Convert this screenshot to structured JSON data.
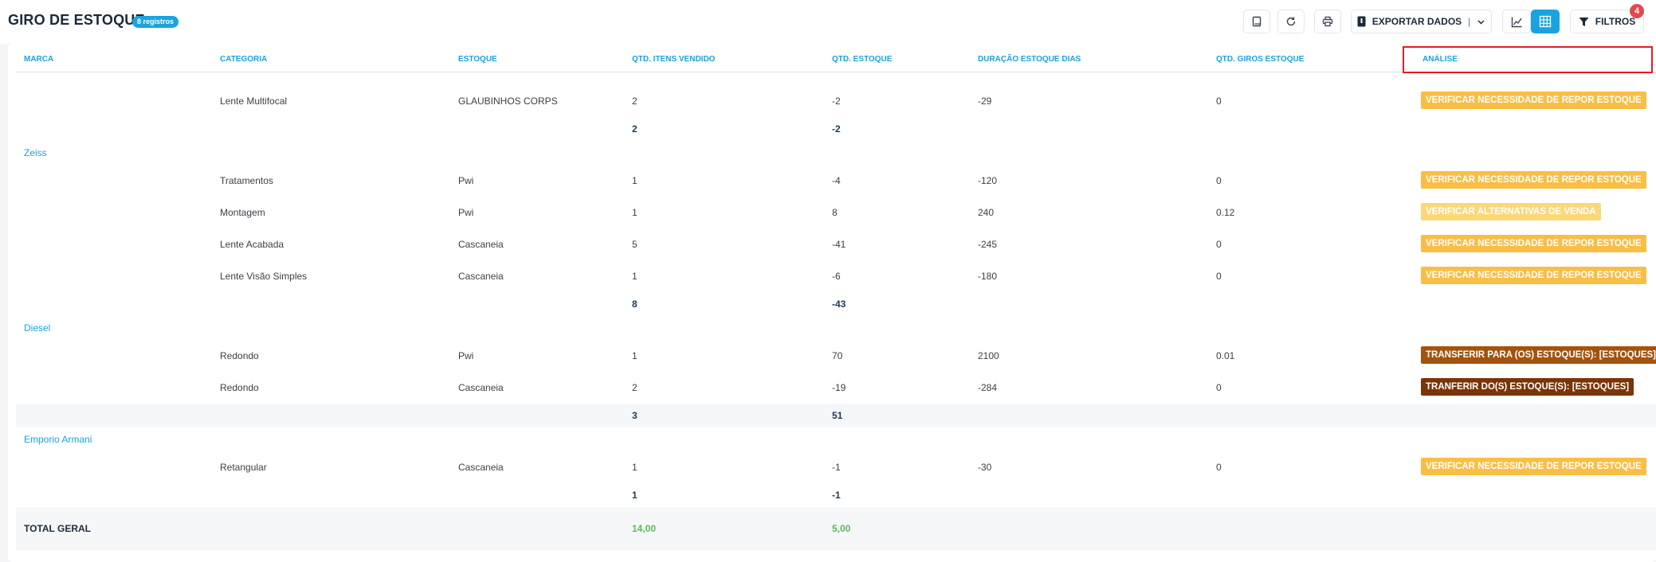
{
  "header": {
    "title": "GIRO DE ESTOQUE",
    "records_badge": "8 registros",
    "export_label": "EXPORTAR DADOS",
    "export_separator": "|",
    "filters_label": "FILTROS",
    "filters_count": "4"
  },
  "icons": {
    "book": "book-icon",
    "refresh": "refresh-icon",
    "print": "print-icon",
    "export": "export-file-icon",
    "chevron": "chevron-down-icon",
    "chart": "chart-icon",
    "grid": "grid-icon",
    "filter": "filter-icon"
  },
  "colors": {
    "accent": "#1aa3e0",
    "orange": "#f9be45",
    "yellow": "#fbd877",
    "brown": "#a3530e",
    "dark_brown": "#7b3407",
    "total_green": "#5cb85c",
    "highlight_red": "#e11d2a"
  },
  "table": {
    "columns": {
      "marca": "MARCA",
      "categoria": "CATEGORIA",
      "estoque": "ESTOQUE",
      "qtd_vendido": "QTD. ITENS VENDIDO",
      "qtd_estoque": "QTD. ESTOQUE",
      "duracao": "DURAÇÃO ESTOQUE DIAS",
      "giros": "QTD. GIROS ESTOQUE",
      "analise": "ANÁLISE"
    },
    "groups": [
      {
        "brand": "",
        "rows": [
          {
            "categoria": "Lente Multifocal",
            "estoque": "GLAUBINHOS CORPS",
            "vendido": "2",
            "estoque_qtd": "-2",
            "duracao": "-29",
            "giros": "0",
            "analise": "VERIFICAR NECESSIDADE DE REPOR ESTOQUE"
          }
        ],
        "subtotal": {
          "vendido": "2",
          "estoque_qtd": "-2"
        }
      },
      {
        "brand": "Zeiss",
        "rows": [
          {
            "categoria": "Tratamentos",
            "estoque": "Pwi",
            "vendido": "1",
            "estoque_qtd": "-4",
            "duracao": "-120",
            "giros": "0",
            "analise": "VERIFICAR NECESSIDADE DE REPOR ESTOQUE"
          },
          {
            "categoria": "Montagem",
            "estoque": "Pwi",
            "vendido": "1",
            "estoque_qtd": "8",
            "duracao": "240",
            "giros": "0.12",
            "analise": "VERIFICAR ALTERNATIVAS DE VENDA"
          },
          {
            "categoria": "Lente Acabada",
            "estoque": "Cascaneia",
            "vendido": "5",
            "estoque_qtd": "-41",
            "duracao": "-245",
            "giros": "0",
            "analise": "VERIFICAR NECESSIDADE DE REPOR ESTOQUE"
          },
          {
            "categoria": "Lente Visão Simples",
            "estoque": "Cascaneia",
            "vendido": "1",
            "estoque_qtd": "-6",
            "duracao": "-180",
            "giros": "0",
            "analise": "VERIFICAR NECESSIDADE DE REPOR ESTOQUE"
          }
        ],
        "subtotal": {
          "vendido": "8",
          "estoque_qtd": "-43"
        }
      },
      {
        "brand": "Diesel",
        "rows": [
          {
            "categoria": "Redondo",
            "estoque": "Pwi",
            "vendido": "1",
            "estoque_qtd": "70",
            "duracao": "2100",
            "giros": "0.01",
            "analise": "TRANSFERIR PARA (OS) ESTOQUE(S): [ESTOQUES]"
          },
          {
            "categoria": "Redondo",
            "estoque": "Cascaneia",
            "vendido": "2",
            "estoque_qtd": "-19",
            "duracao": "-284",
            "giros": "0",
            "analise": "TRANFERIR DO(S) ESTOQUE(S): [ESTOQUES]"
          }
        ],
        "subtotal": {
          "vendido": "3",
          "estoque_qtd": "51"
        }
      },
      {
        "brand": "Emporio Armani",
        "rows": [
          {
            "categoria": "Retangular",
            "estoque": "Cascaneia",
            "vendido": "1",
            "estoque_qtd": "-1",
            "duracao": "-30",
            "giros": "0",
            "analise": "VERIFICAR NECESSIDADE DE REPOR ESTOQUE"
          }
        ],
        "subtotal": {
          "vendido": "1",
          "estoque_qtd": "-1"
        }
      }
    ],
    "total": {
      "label": "TOTAL GERAL",
      "vendido": "14,00",
      "estoque_qtd": "5,00"
    }
  }
}
